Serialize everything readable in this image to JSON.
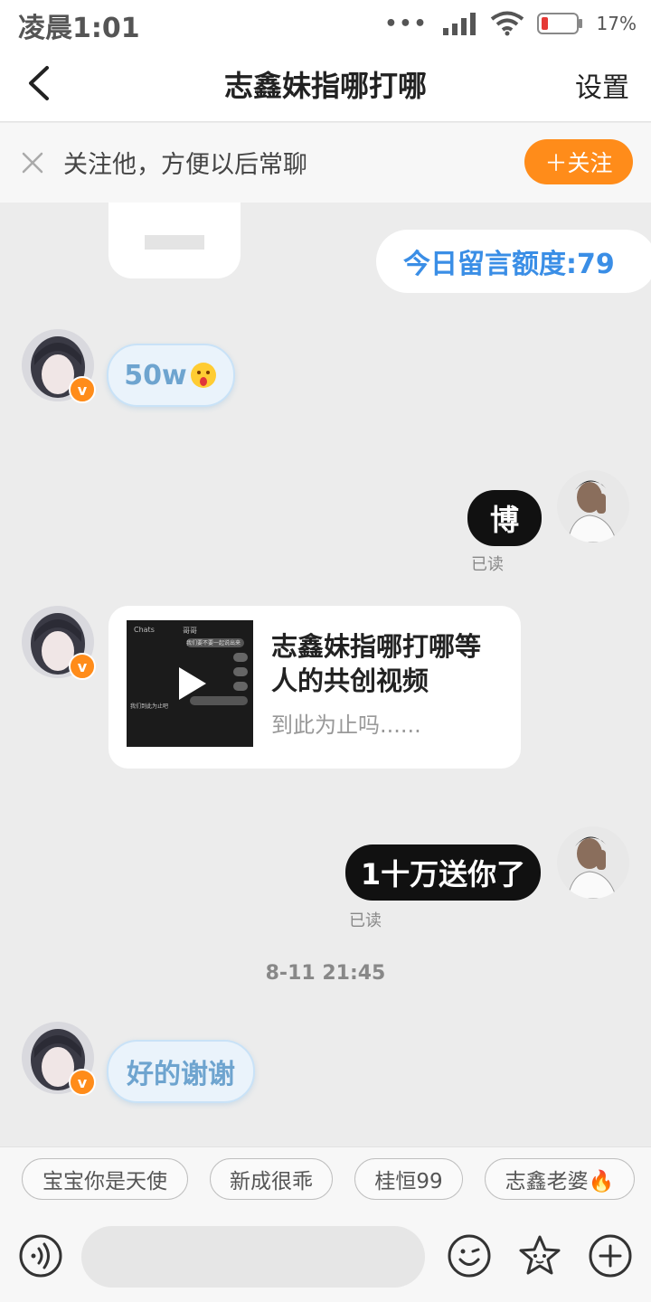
{
  "status_bar": {
    "time": "凌晨1:01",
    "dots": "•••",
    "battery_percent": "17%",
    "icons": [
      "signal-icon",
      "wifi-icon",
      "battery-icon"
    ]
  },
  "nav": {
    "title": "志鑫妹指哪打哪",
    "settings_label": "设置"
  },
  "follow_banner": {
    "text": "关注他，方便以后常聊",
    "button_label": "＋关注"
  },
  "messages": {
    "quota": "今日留言额度:79",
    "incoming_1": "50w",
    "outgoing_1": "博",
    "outgoing_1_status": "已读",
    "video_card": {
      "title": "志鑫妹指哪打哪等人的共创视频",
      "subtitle": "到此为止吗......",
      "thumb_header_left": "Chats",
      "thumb_header_center": "哥哥",
      "thumb_lines": [
        "我们要不要一起说出来",
        "",
        "我们到此为止吧"
      ]
    },
    "outgoing_2": "1十万送你了",
    "outgoing_2_status": "已读",
    "timestamp": "8-11 21:45",
    "incoming_2": "好的谢谢"
  },
  "quick_replies": [
    "宝宝你是天使",
    "新成很乖",
    "桂恒99",
    "志鑫老婆🔥"
  ],
  "input": {
    "placeholder": ""
  },
  "colors": {
    "accent_orange": "#ff8c1a",
    "quota_blue": "#3a8ee6",
    "cute_bubble_text": "#6ea4cf"
  }
}
